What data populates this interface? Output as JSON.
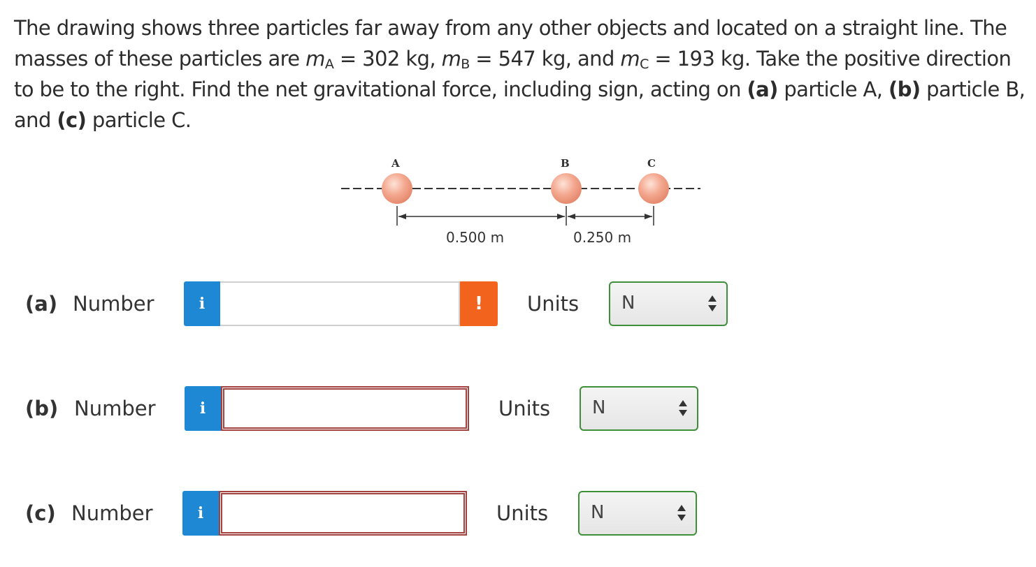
{
  "question": {
    "p1": "The drawing shows three particles far away from any other objects and located on a straight line. The masses of these particles are ",
    "m": "m",
    "sub_a": "A",
    "eq_a": " = 302 kg, ",
    "sub_b": "B",
    "eq_b": " = 547 kg, and ",
    "sub_c": "C",
    "eq_c": " = 193 kg. Take the positive direction to be to the right. Find the net gravitational force, including sign, acting on ",
    "part_a": "(a)",
    "t_a": " particle A, ",
    "part_b": "(b)",
    "t_b": " particle B, and ",
    "part_c": "(c)",
    "t_c": " particle C."
  },
  "figure": {
    "label_a": "A",
    "label_b": "B",
    "label_c": "C",
    "dist_ab": "0.500 m",
    "dist_bc": "0.250 m"
  },
  "answers": [
    {
      "part": "(a)",
      "number_label": "Number",
      "info_icon": "i",
      "value": "",
      "alert_icon": "!",
      "units_label": "Units",
      "unit": "N"
    },
    {
      "part": "(b)",
      "number_label": "Number",
      "info_icon": "i",
      "value": "",
      "units_label": "Units",
      "unit": "N"
    },
    {
      "part": "(c)",
      "number_label": "Number",
      "info_icon": "i",
      "value": "",
      "units_label": "Units",
      "unit": "N"
    }
  ],
  "colors": {
    "info": "#1e88d4",
    "alert": "#f2631d",
    "error_border": "#a3413f",
    "select_border": "#3f8f3a",
    "particle": "#f2a38d"
  }
}
